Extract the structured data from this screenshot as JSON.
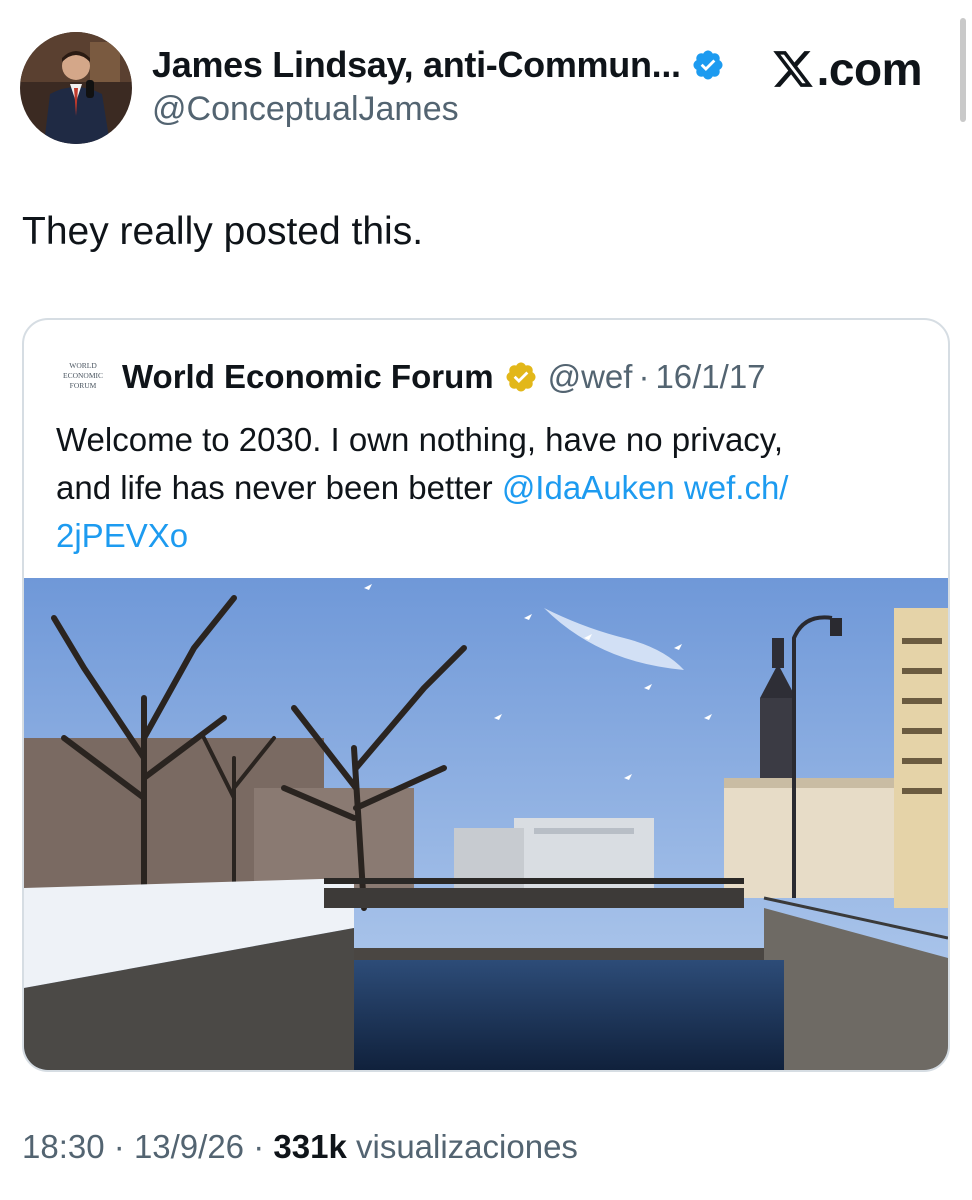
{
  "author": {
    "display_name": "James Lindsay, anti-Commun...",
    "handle": "@ConceptualJames",
    "verified_icon": "blue-verified-badge-icon"
  },
  "brand": {
    "label": ".com",
    "icon": "x-logo-icon"
  },
  "tweet": {
    "text": "They really posted this."
  },
  "quoted_tweet": {
    "author_name": "World Economic Forum",
    "logo_text": [
      "WORLD",
      "ECONOMIC",
      "FORUM"
    ],
    "badge_icon": "gold-verified-badge-icon",
    "handle": "@wef",
    "separator": "·",
    "date": "16/1/17",
    "text_line1": "Welcome to 2030. I own nothing, have no privacy,",
    "text_line2": "and life has never been better ",
    "mention": "@IdaAuken",
    "link_part1": "wef.ch/",
    "link_part2": "2jPEVXo"
  },
  "footer": {
    "time": "18:30",
    "separator": "·",
    "date": "13/9/26",
    "views_count": "331k",
    "views_label": "visualizaciones"
  },
  "colors": {
    "text": "#0f1419",
    "secondary": "#536471",
    "link": "#1d9bf0",
    "verified_blue": "#1d9bf0",
    "verified_gold": "#e2b719",
    "card_border": "#d6dde3"
  }
}
